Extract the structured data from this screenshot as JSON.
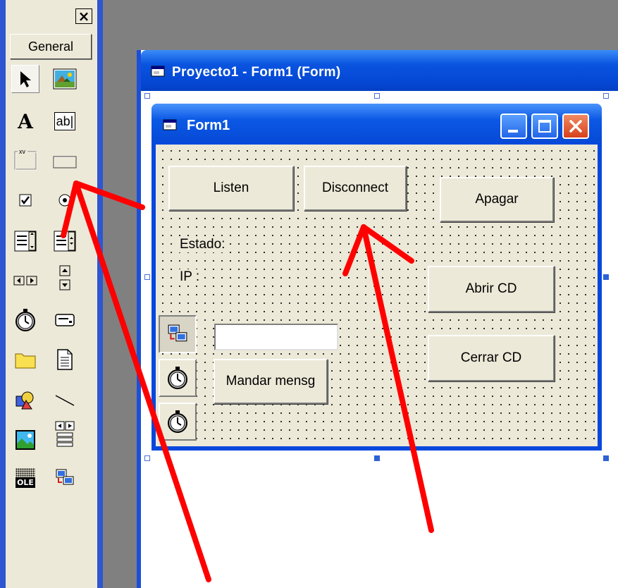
{
  "toolbox": {
    "close_glyph": "×",
    "tab_label": "General",
    "tools": [
      {
        "name": "pointer-tool-icon"
      },
      {
        "name": "picturebox-tool-icon"
      },
      {
        "name": "label-tool-icon",
        "glyph": "A"
      },
      {
        "name": "textbox-tool-icon",
        "glyph": "ab|"
      },
      {
        "name": "frame-tool-icon",
        "glyph": "xv"
      },
      {
        "name": "commandbutton-tool-icon"
      },
      {
        "name": "checkbox-tool-icon"
      },
      {
        "name": "optionbutton-tool-icon"
      },
      {
        "name": "combobox-tool-icon"
      },
      {
        "name": "listbox-tool-icon"
      },
      {
        "name": "hscrollbar-tool-icon"
      },
      {
        "name": "vscrollbar-tool-icon"
      },
      {
        "name": "timer-tool-icon"
      },
      {
        "name": "drivelistbox-tool-icon"
      },
      {
        "name": "dirlistbox-tool-icon"
      },
      {
        "name": "filelistbox-tool-icon"
      },
      {
        "name": "shape-tool-icon"
      },
      {
        "name": "line-tool-icon"
      },
      {
        "name": "image-tool-icon"
      },
      {
        "name": "data-tool-icon"
      },
      {
        "name": "ole-tool-icon",
        "glyph": "OLE"
      },
      {
        "name": "winsock-tool-icon"
      }
    ]
  },
  "designer": {
    "title": "Proyecto1 - Form1 (Form)"
  },
  "form": {
    "title": "Form1",
    "buttons": {
      "listen": "Listen",
      "disconnect": "Disconnect",
      "apagar": "Apagar",
      "abrir_cd": "Abrir CD",
      "cerrar_cd": "Cerrar CD",
      "mandar": "Mandar mensg"
    },
    "labels": {
      "estado": "Estado:",
      "ip": "IP :"
    },
    "message_input_value": ""
  },
  "colors": {
    "annotation_arrow": "#ff0000",
    "title_bar": "#0a54e0"
  }
}
